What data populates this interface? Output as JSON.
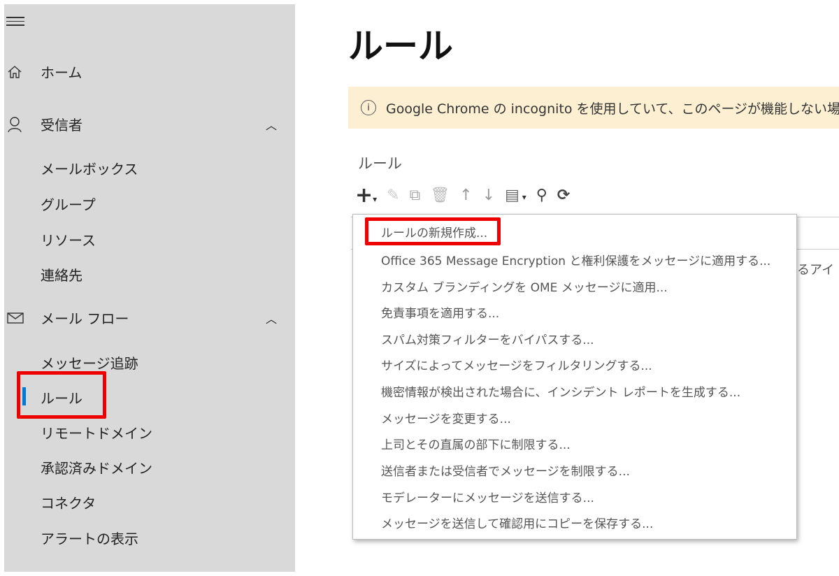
{
  "sidebar": {
    "home": "ホーム",
    "recipients": {
      "label": "受信者",
      "items": [
        "メールボックス",
        "グループ",
        "リソース",
        "連絡先"
      ]
    },
    "mailflow": {
      "label": "メール フロー",
      "items": [
        "メッセージ追跡",
        "ルール",
        "リモートドメイン",
        "承認済みドメイン",
        "コネクタ",
        "アラートの表示"
      ]
    }
  },
  "main": {
    "title": "ルール",
    "banner": "Google Chrome の incognito を使用していて、このページが機能しない場合は",
    "section": "ルール",
    "behind_text": "るアイ",
    "menu": [
      "ルールの新規作成...",
      "Office 365 Message Encryption と権利保護をメッセージに適用する...",
      "カスタム ブランディングを OME メッセージに適用...",
      "免責事項を適用する...",
      "スパム対策フィルターをバイパスする...",
      "サイズによってメッセージをフィルタリングする...",
      "機密情報が検出された場合に、インシデント レポートを生成する...",
      "メッセージを変更する...",
      "上司とその直属の部下に制限する...",
      "送信者または受信者でメッセージを制限する...",
      "モデレーターにメッセージを送信する...",
      "メッセージを送信して確認用にコピーを保存する..."
    ]
  },
  "colors": {
    "highlight": "#ee0000",
    "accent": "#0078d4",
    "banner": "#fdf0d2"
  }
}
